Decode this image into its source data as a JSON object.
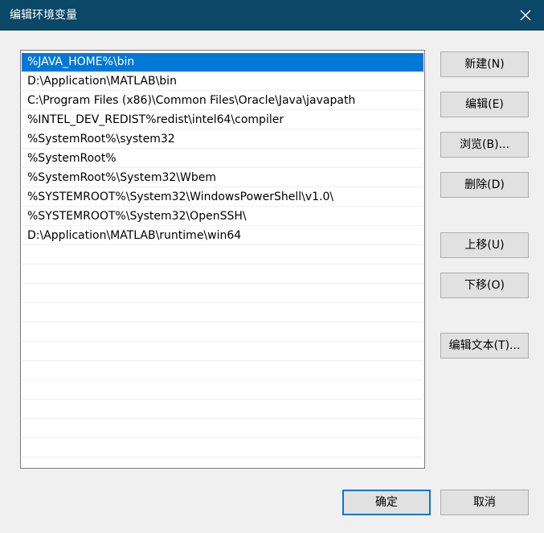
{
  "window": {
    "title": "编辑环境变量",
    "close_icon": "close-icon"
  },
  "list": {
    "items": [
      {
        "label": "%JAVA_HOME%\\bin",
        "selected": true
      },
      {
        "label": "D:\\Application\\MATLAB\\bin",
        "selected": false
      },
      {
        "label": "C:\\Program Files (x86)\\Common Files\\Oracle\\Java\\javapath",
        "selected": false
      },
      {
        "label": "%INTEL_DEV_REDIST%redist\\intel64\\compiler",
        "selected": false
      },
      {
        "label": "%SystemRoot%\\system32",
        "selected": false
      },
      {
        "label": "%SystemRoot%",
        "selected": false
      },
      {
        "label": "%SystemRoot%\\System32\\Wbem",
        "selected": false
      },
      {
        "label": "%SYSTEMROOT%\\System32\\WindowsPowerShell\\v1.0\\",
        "selected": false
      },
      {
        "label": "%SYSTEMROOT%\\System32\\OpenSSH\\",
        "selected": false
      },
      {
        "label": "D:\\Application\\MATLAB\\runtime\\win64",
        "selected": false
      }
    ]
  },
  "buttons": {
    "new": "新建(N)",
    "edit": "编辑(E)",
    "browse": "浏览(B)...",
    "delete": "删除(D)",
    "move_up": "上移(U)",
    "move_down": "下移(O)",
    "edit_text": "编辑文本(T)...",
    "ok": "确定",
    "cancel": "取消"
  },
  "colors": {
    "titlebar": "#0b4766",
    "selection": "#0078d7"
  }
}
